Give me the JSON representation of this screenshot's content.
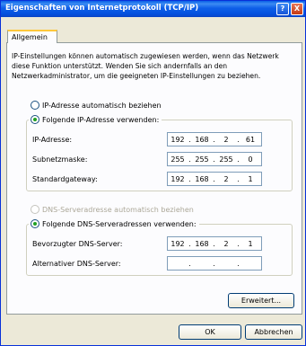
{
  "window": {
    "title": "Eigenschaften von Internetprotokoll (TCP/IP)"
  },
  "titlebar": {
    "help_label": "?",
    "close_label": "X"
  },
  "tabs": [
    {
      "label": "Allgemein"
    }
  ],
  "description": "IP-Einstellungen können automatisch zugewiesen werden, wenn das Netzwerk diese Funktion unterstützt. Wenden Sie sich andernfalls an den Netzwerkadministrator, um die geeigneten IP-Einstellungen zu beziehen.",
  "ip_mode": {
    "auto_label": "IP-Adresse automatisch beziehen",
    "auto_checked": false,
    "manual_label": "Folgende IP-Adresse verwenden:",
    "manual_checked": true
  },
  "ip_fields": {
    "ip_address": {
      "label": "IP-Adresse:",
      "octets": [
        "192",
        "168",
        "2",
        "61"
      ]
    },
    "subnet_mask": {
      "label": "Subnetzmaske:",
      "octets": [
        "255",
        "255",
        "255",
        "0"
      ]
    },
    "gateway": {
      "label": "Standardgateway:",
      "octets": [
        "192",
        "168",
        "2",
        "1"
      ]
    }
  },
  "dns_mode": {
    "auto_label": "DNS-Serveradresse automatisch beziehen",
    "auto_checked": false,
    "auto_disabled": true,
    "manual_label": "Folgende DNS-Serveradressen verwenden:",
    "manual_checked": true
  },
  "dns_fields": {
    "preferred": {
      "label": "Bevorzugter DNS-Server:",
      "octets": [
        "192",
        "168",
        "2",
        "1"
      ]
    },
    "alternate": {
      "label": "Alternativer DNS-Server:",
      "octets": [
        "",
        "",
        "",
        ""
      ]
    }
  },
  "buttons": {
    "advanced": "Erweitert...",
    "ok": "OK",
    "cancel": "Abbrechen"
  }
}
